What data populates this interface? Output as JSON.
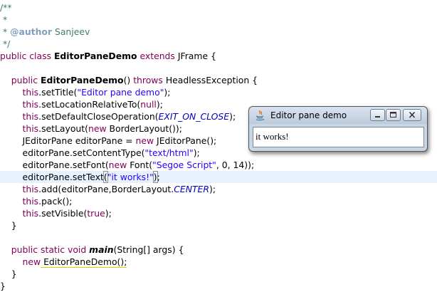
{
  "editor": {
    "lines": {
      "l1": "/**",
      "l2": " *",
      "l3_tag": "@author",
      "l3_name": " Sanjeev",
      "l4": " */",
      "l5_public": "public",
      "l5_class": "class",
      "l5_name": "EditorPaneDemo",
      "l5_extends": "extends",
      "l5_rest": " JFrame {",
      "l7_public": "public",
      "l7_name": "EditorPaneDemo",
      "l7_mid": "() ",
      "l7_throws": "throws",
      "l7_rest": " HeadlessException {",
      "l8_this": "this",
      "l8_call": ".setTitle(",
      "l8_str": "\"Editor pane demo\"",
      "l8_end": ");",
      "l9_this": "this",
      "l9_call": ".setLocationRelativeTo(",
      "l9_null": "null",
      "l9_end": ");",
      "l10_this": "this",
      "l10_call": ".setDefaultCloseOperation(",
      "l10_const": "EXIT_ON_CLOSE",
      "l10_end": ");",
      "l11_this": "this",
      "l11_call": ".setLayout(",
      "l11_new": "new",
      "l11_end": " BorderLayout());",
      "l12_a": "JEditorPane editorPane = ",
      "l12_new": "new",
      "l12_end": " JEditorPane();",
      "l13_call": "editorPane.setContentType(",
      "l13_str": "\"text/html\"",
      "l13_end": ");",
      "l14_call": "editorPane.setFont(",
      "l14_new": "new",
      "l14_mid": " Font(",
      "l14_str": "\"Segoe Script\"",
      "l14_end": ", 0, 14));",
      "l15_call": "editorPane.setText",
      "l15_open": "(",
      "l15_str": "\"it works!\"",
      "l15_close": ")",
      "l15_end": ";",
      "l16_this": "this",
      "l16_call": ".add(editorPane,BorderLayout.",
      "l16_const": "CENTER",
      "l16_end": ");",
      "l17_this": "this",
      "l17_end": ".pack();",
      "l18_this": "this",
      "l18_call": ".setVisible(",
      "l18_true": "true",
      "l18_end": ");",
      "l19": "}",
      "l21_public": "public",
      "l21_static": "static",
      "l21_void": "void",
      "l21_main": "main",
      "l21_rest": "(String[] args) {",
      "l22_new": "new",
      "l22_end": " EditorPaneDemo();",
      "l23": "}",
      "l24": "}"
    }
  },
  "window": {
    "title": "Editor pane demo",
    "content": "it works!"
  },
  "colors": {
    "keyword": "#7f0055",
    "string": "#2a00ff",
    "comment": "#3f7f5f",
    "constant": "#0000c0"
  }
}
